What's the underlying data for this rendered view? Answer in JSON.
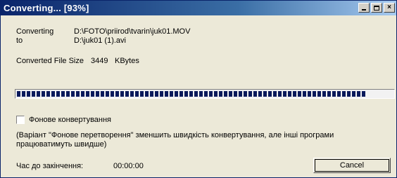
{
  "window": {
    "title": "Converting... [93%]",
    "buttons": {
      "minimize": "minimize-icon",
      "maximize": "maximize-icon",
      "close": "close-icon",
      "close_glyph": "×"
    }
  },
  "conversion": {
    "from_label": "Converting",
    "from_path": "D:\\FOTO\\priirod\\tvarin\\juk01.MOV",
    "to_label": "to",
    "to_path": "D:\\juk01 (1).avi",
    "size_label": "Converted File Size",
    "size_value": "3449",
    "size_unit": "KBytes"
  },
  "progress": {
    "percent": 93
  },
  "background_option": {
    "label": "Фонове конвертування",
    "checked": false
  },
  "note": "(Варіант \"Фонове перетворення\" зменшить швидкість конвертування, але інші програми працюватимуть швидше)",
  "time_remaining": {
    "label": "Час до закінчення:",
    "value": "00:00:00"
  },
  "actions": {
    "cancel_label": "Cancel"
  },
  "colors": {
    "titlebar_start": "#0a246a",
    "titlebar_end": "#a6caf0",
    "progress_fill": "#0a1a5c",
    "window_bg": "#ece9d8"
  }
}
